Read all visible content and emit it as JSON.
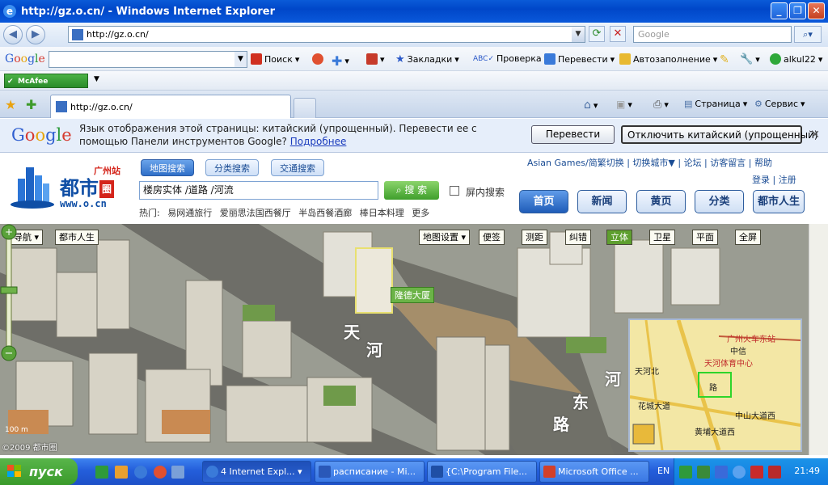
{
  "window": {
    "title": "http://gz.o.cn/ - Windows Internet Explorer"
  },
  "address": {
    "url": "http://gz.o.cn/",
    "search_placeholder": "Google"
  },
  "google_toolbar": {
    "search": "Поиск",
    "bookmarks": "Закладки",
    "check": "Проверка",
    "translate": "Перевести",
    "autofill": "Автозаполнение",
    "user": "alkul22"
  },
  "mcafee": {
    "label": "McAfee SiteAdvisor"
  },
  "tabs": {
    "active_tab": "http://gz.o.cn/",
    "page_menu": "Страница",
    "tools_menu": "Сервис"
  },
  "translate_bar": {
    "message": "Язык отображения этой страницы: китайский (упрощенный). Перевести ее с помощью Панели инструментов Google?",
    "more_link": "Подробнее",
    "translate_button": "Перевести",
    "disable_button": "Отключить китайский (упрощенный)"
  },
  "site": {
    "brand": "都市",
    "brand_seal": "圈",
    "city": "广州站",
    "url": "www.o.cn",
    "search_tabs": [
      "地图搜索",
      "分类搜索",
      "交通搜索"
    ],
    "search_value": "楼房实体 /道路 /河流",
    "search_button": "搜 索",
    "in_screen": "屏内搜索",
    "hot_label": "热门:",
    "hot_items": [
      "易网通旅行",
      "爱丽思法国西餐厅",
      "半岛西餐酒廊",
      "棒日本料理",
      "更多"
    ],
    "top_links": "Asian Games/简繁切换 | 切换城市▼ | 论坛 | 访客留言 | 帮助",
    "login_links": "登录 | 注册",
    "main_nav": [
      "首页",
      "新闻",
      "黄页",
      "分类",
      "都市人生"
    ]
  },
  "map": {
    "left_buttons": [
      "导航",
      "都市人生"
    ],
    "right_buttons": [
      "地图设置",
      "便签",
      "测距",
      "纠错",
      "立体",
      "卫星",
      "平面",
      "全屏"
    ],
    "building_label": "隆德大厦",
    "road_labels": [
      "天",
      "河",
      "东",
      "路",
      "河"
    ],
    "scale": "100 m",
    "copyright": "©2009 都市圈",
    "minimap_labels": [
      "广州火车东站",
      "中信",
      "天河体育中心",
      "中山大道西",
      "黄埔大道西",
      "花城大道",
      "天河北",
      "路"
    ]
  },
  "taskbar": {
    "start": "пуск",
    "tasks": [
      "4 Internet Expl...",
      "расписание - Mi...",
      "{C:\\Program File...",
      "Microsoft Office ..."
    ],
    "lang": "EN",
    "clock": "21:49"
  }
}
